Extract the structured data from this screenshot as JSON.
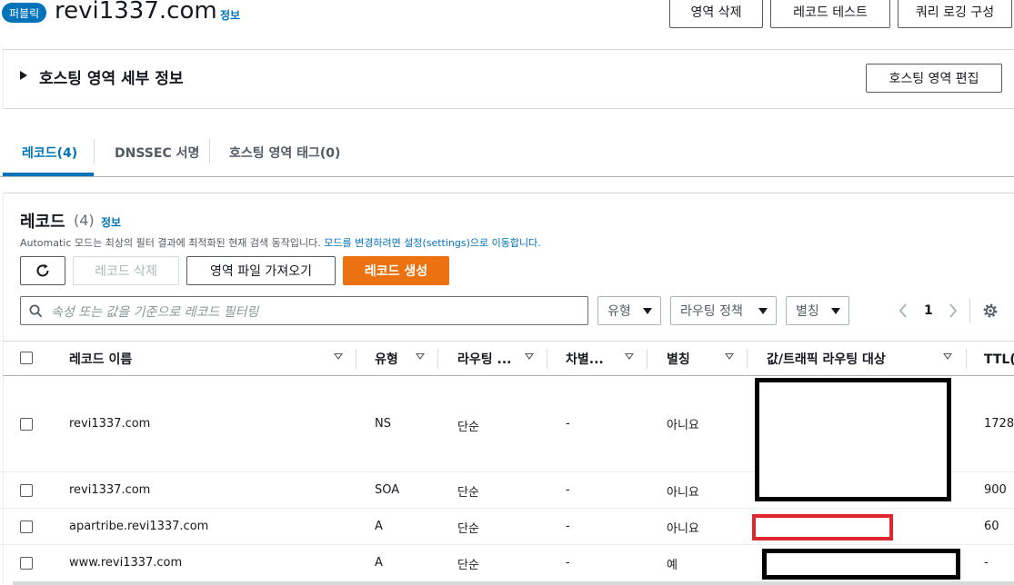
{
  "header": {
    "badge": "퍼블릭",
    "zone_name": "revi1337.com",
    "info": "정보",
    "buttons": {
      "delete_zone": "영역 삭제",
      "test_record": "레코드 테스트",
      "query_logging": "쿼리 로깅 구성"
    }
  },
  "details": {
    "title": "호스팅 영역 세부 정보",
    "edit_button": "호스팅 영역 편집"
  },
  "tabs": [
    {
      "label": "레코드(4)",
      "active": true
    },
    {
      "label": "DNSSEC 서명",
      "active": false
    },
    {
      "label": "호스팅 영역 태그(0)",
      "active": false
    }
  ],
  "records": {
    "title": "레코드",
    "count": "(4)",
    "info": "정보",
    "mode_text": "Automatic 모드는 최상의 필터 결과에 최적화된 현재 검색 동작입니다.",
    "mode_link": "모드를 변경하려면 설정(settings)으로 이동합니다.",
    "buttons": {
      "delete": "레코드 삭제",
      "import": "영역 파일 가져오기",
      "create": "레코드 생성"
    },
    "search_placeholder": "속성 또는 값을 기준으로 레코드 필터링",
    "filters": {
      "type": "유형",
      "routing": "라우팅 정책",
      "alias": "별칭"
    },
    "page": "1",
    "columns": {
      "name": "레코드 이름",
      "type": "유형",
      "routing": "라우팅 ...",
      "diff": "차별...",
      "alias": "별칭",
      "value": "값/트래픽 라우팅 대상",
      "ttl": "TTL(초"
    },
    "rows": [
      {
        "name": "revi1337.com",
        "type": "NS",
        "routing": "단순",
        "diff": "-",
        "alias": "아니요",
        "ttl": "1728"
      },
      {
        "name": "revi1337.com",
        "type": "SOA",
        "routing": "단순",
        "diff": "-",
        "alias": "아니요",
        "ttl": "900"
      },
      {
        "name": "apartribe.revi1337.com",
        "type": "A",
        "routing": "단순",
        "diff": "-",
        "alias": "아니요",
        "ttl": "60"
      },
      {
        "name": "www.revi1337.com",
        "type": "A",
        "routing": "단순",
        "diff": "-",
        "alias": "예",
        "ttl": "-"
      }
    ]
  },
  "colors": {
    "link": "#0073bb",
    "primary": "#ec7211",
    "badge": "#0073bb",
    "redaction": "#000000",
    "redaction_alt": "#e0262f"
  }
}
